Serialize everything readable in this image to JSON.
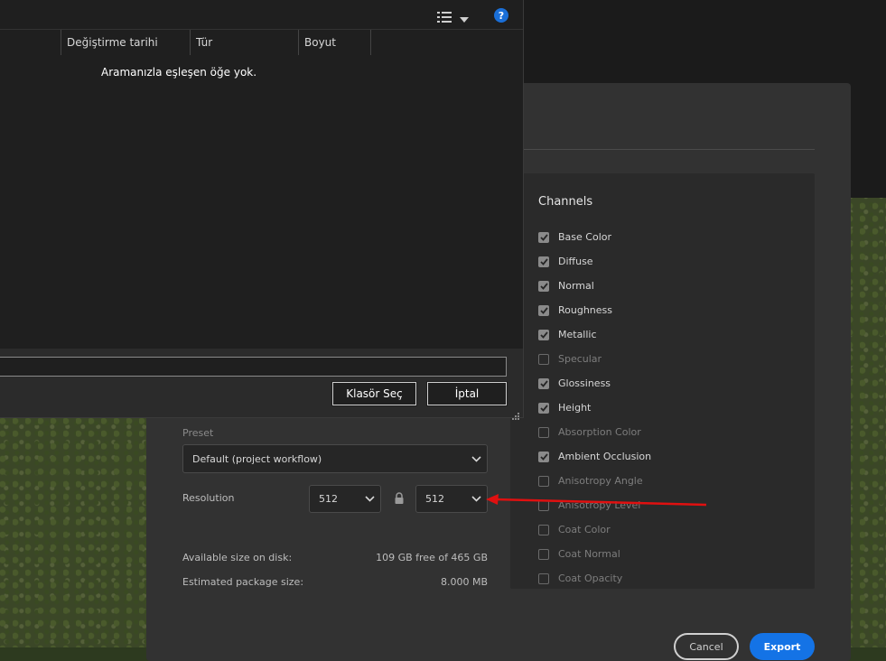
{
  "folder_dialog": {
    "columns": [
      "Değiştirme tarihi",
      "Tür",
      "Boyut"
    ],
    "empty_message": "Aramanızla eşleşen öğe yok.",
    "path_value": "",
    "select_folder_label": "Klasör Seç",
    "cancel_label": "İptal",
    "help_label": "?"
  },
  "export_dialog": {
    "channels_title": "Channels",
    "channels": [
      {
        "label": "Base Color",
        "checked": true
      },
      {
        "label": "Diffuse",
        "checked": true
      },
      {
        "label": "Normal",
        "checked": true
      },
      {
        "label": "Roughness",
        "checked": true
      },
      {
        "label": "Metallic",
        "checked": true
      },
      {
        "label": "Specular",
        "checked": false
      },
      {
        "label": "Glossiness",
        "checked": true
      },
      {
        "label": "Height",
        "checked": true
      },
      {
        "label": "Absorption Color",
        "checked": false
      },
      {
        "label": "Ambient Occlusion",
        "checked": true
      },
      {
        "label": "Anisotropy Angle",
        "checked": false
      },
      {
        "label": "Anisotropy Level",
        "checked": false
      },
      {
        "label": "Coat Color",
        "checked": false
      },
      {
        "label": "Coat Normal",
        "checked": false
      },
      {
        "label": "Coat Opacity",
        "checked": false
      }
    ],
    "preset_label": "Preset",
    "preset_value": "Default (project workflow)",
    "resolution_label": "Resolution",
    "resolution_width": "512",
    "resolution_height": "512",
    "disk_label": "Available size on disk:",
    "disk_value": "109 GB free of 465 GB",
    "package_label": "Estimated package size:",
    "package_value": "8.000 MB",
    "cancel_label": "Cancel",
    "export_label": "Export"
  },
  "colors": {
    "accent": "#1473e6",
    "annotation_arrow": "#e01010"
  }
}
